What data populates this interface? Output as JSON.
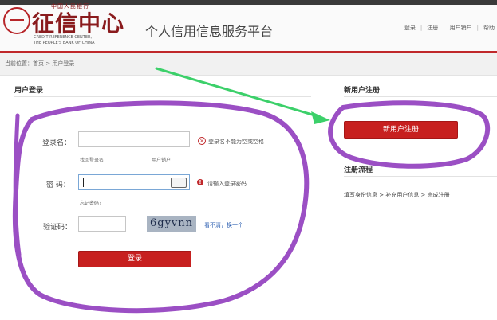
{
  "header": {
    "logo_small": "中国人民银行",
    "logo_main": "征信中心",
    "logo_en_line1": "CREDIT REFERENCE CENTER,",
    "logo_en_line2": "THE PEOPLE'S BANK OF CHINA",
    "platform_title": "个人信用信息服务平台",
    "nav": {
      "login": "登录",
      "sep": "|",
      "register": "注册",
      "cancel_user": "用户销户",
      "help": "帮助"
    }
  },
  "breadcrumb": "当前位置：首页 > 用户登录",
  "login_panel": {
    "title": "用户登录",
    "username_label": "登录名：",
    "username_error": "登录名不能为空或空格",
    "find_username": "找回登录名",
    "cancel_user": "用户销户",
    "password_label": "密  码：",
    "password_error": "请输入登录密码",
    "forgot_password": "忘记密码？",
    "captcha_label": "验证码：",
    "captcha_text": "6gyvnn",
    "captcha_refresh": "看不清，换一个",
    "login_button": "登录"
  },
  "new_user": {
    "title": "新用户注册",
    "register_button": "新用户注册",
    "process_title": "注册流程",
    "steps": "填写身份信息 > 补充用户信息 > 完成注册"
  },
  "colors": {
    "brand_red": "#c7201f",
    "annotation_purple": "#9b4fc4",
    "arrow_green": "#3cd06a"
  }
}
